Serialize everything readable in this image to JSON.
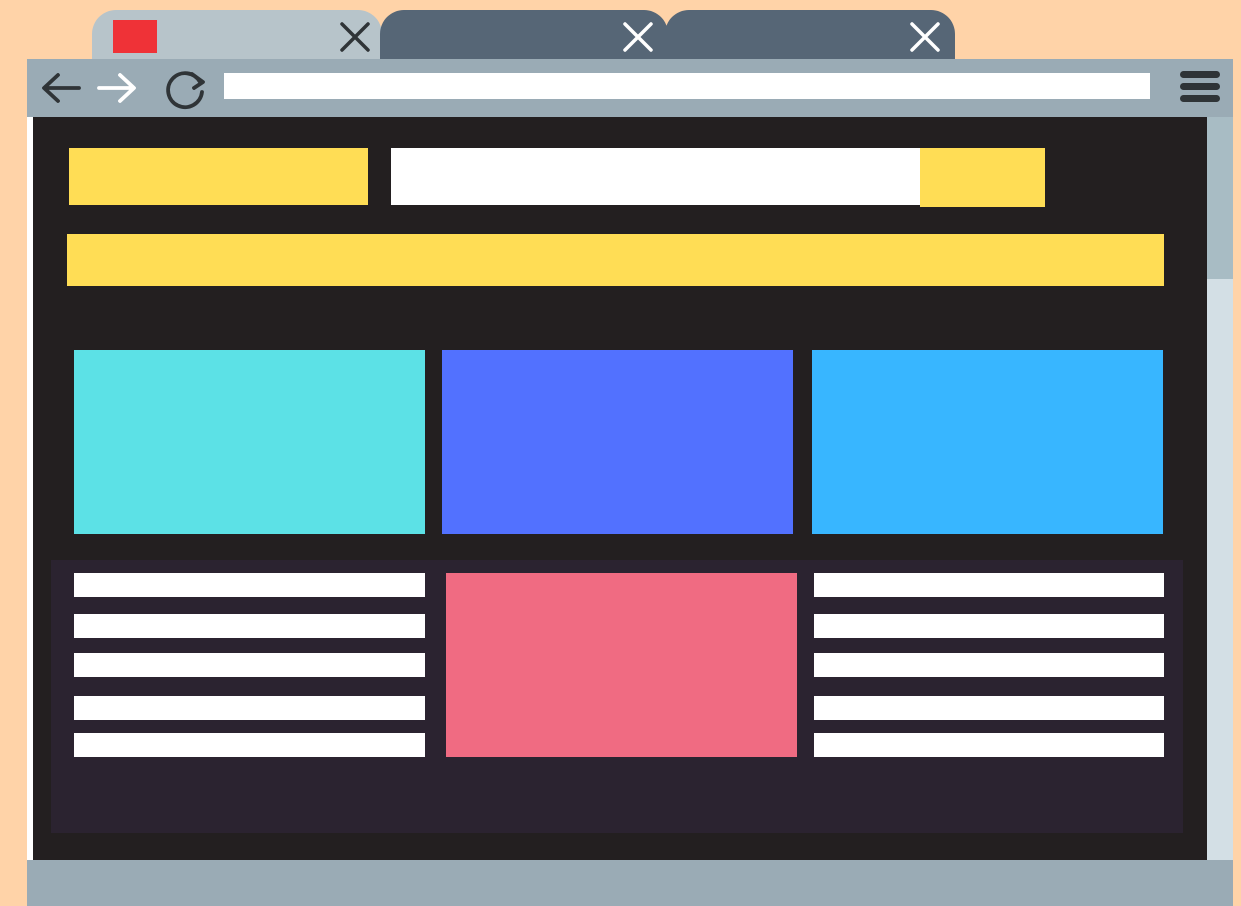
{
  "colors": {
    "page_bg": "#ffd3a8",
    "tab_active": "#b7c4ca",
    "tab_inactive": "#566676",
    "favicon": "#ef3237",
    "toolbar": "#9aabb5",
    "viewport": "#231f20",
    "accent_yellow": "#ffdd55",
    "card_cyan": "#5ce1e6",
    "card_blue": "#5271ff",
    "card_sky": "#38b6ff",
    "card_pink": "#f06b82",
    "content_panel": "#2b2330",
    "scroll_track": "#d3dfe5",
    "scroll_thumb": "#a8bcc4",
    "status_bar": "#9aabb5"
  },
  "icons": {
    "tab_close": "close-icon",
    "back": "arrow-left-icon",
    "forward": "arrow-right-icon",
    "reload": "reload-icon",
    "menu": "hamburger-menu-icon",
    "favicon": "favicon-icon"
  },
  "tabs": [
    {
      "label": "",
      "active": true
    },
    {
      "label": "",
      "active": false
    },
    {
      "label": "",
      "active": false
    }
  ],
  "address_bar": {
    "value": ""
  },
  "content_lines": {
    "left_count": 5,
    "right_count": 5
  }
}
